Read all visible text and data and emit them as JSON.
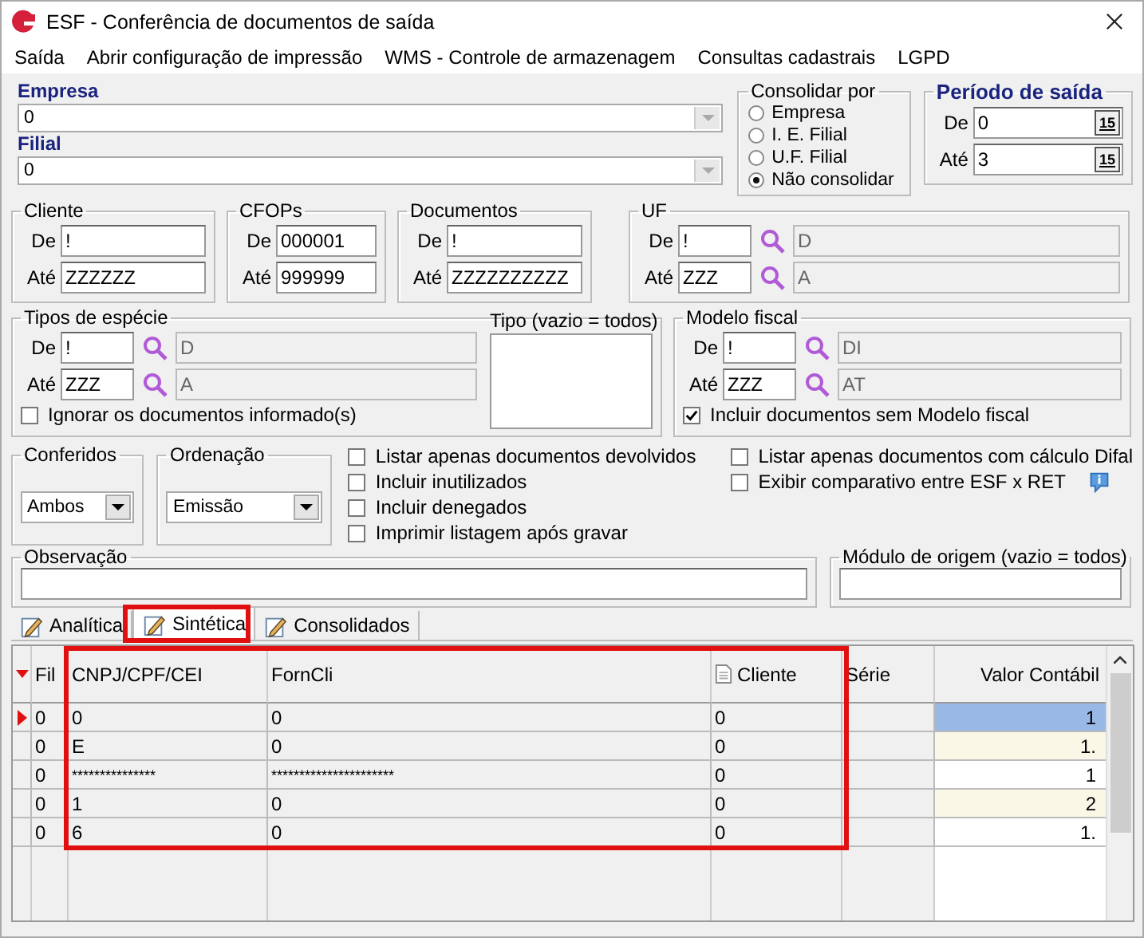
{
  "window": {
    "title": "ESF - Conferência de documentos de saída"
  },
  "menu": [
    "Saída",
    "Abrir configuração de impressão",
    "WMS - Controle de armazenagem",
    "Consultas cadastrais",
    "LGPD"
  ],
  "empresa": {
    "label": "Empresa",
    "value": "0"
  },
  "filial": {
    "label": "Filial",
    "value": "0"
  },
  "consolidar": {
    "title": "Consolidar por",
    "options": [
      {
        "label": "Empresa",
        "selected": false
      },
      {
        "label": "I. E. Filial",
        "selected": false
      },
      {
        "label": "U.F. Filial",
        "selected": false
      },
      {
        "label": "Não consolidar",
        "selected": true
      }
    ]
  },
  "periodo": {
    "title": "Período de saída",
    "rows": [
      {
        "label": "De",
        "value": "0",
        "button": "15"
      },
      {
        "label": "Até",
        "value": "3",
        "button": "15"
      }
    ]
  },
  "ranges": [
    {
      "title": "Cliente",
      "rows": [
        {
          "label": "De",
          "value": "!"
        },
        {
          "label": "Até",
          "value": "ZZZZZZ"
        }
      ]
    },
    {
      "title": "CFOPs",
      "rows": [
        {
          "label": "De",
          "value": "000001"
        },
        {
          "label": "Até",
          "value": "999999"
        }
      ]
    },
    {
      "title": "Documentos",
      "rows": [
        {
          "label": "De",
          "value": "!"
        },
        {
          "label": "Até",
          "value": "ZZZZZZZZZZ"
        }
      ]
    }
  ],
  "uf": {
    "title": "UF",
    "rows": [
      {
        "label": "De",
        "value": "!",
        "description": "D"
      },
      {
        "label": "Até",
        "value": "ZZZ",
        "description": "A"
      }
    ]
  },
  "tipos": {
    "title": "Tipos de espécie",
    "rows": [
      {
        "label": "De",
        "value": "!",
        "description": "D"
      },
      {
        "label": "Até",
        "value": "ZZZ",
        "description": "A"
      }
    ],
    "checkbox": {
      "label": "Ignorar os documentos informado(s)",
      "checked": false
    },
    "tipo_label": "Tipo (vazio = todos)"
  },
  "modelo": {
    "title": "Modelo fiscal",
    "rows": [
      {
        "label": "De",
        "value": "!",
        "description": "DI"
      },
      {
        "label": "Até",
        "value": "ZZZ",
        "description": "AT"
      }
    ],
    "checkbox": {
      "label": "Incluir documentos sem Modelo fiscal",
      "checked": true
    }
  },
  "conferidos": {
    "title": "Conferidos",
    "value": "Ambos"
  },
  "ordenacao": {
    "title": "Ordenação",
    "value": "Emissão"
  },
  "options_left": [
    {
      "label": "Listar apenas documentos devolvidos",
      "checked": false
    },
    {
      "label": "Incluir inutilizados",
      "checked": false
    },
    {
      "label": "Incluir denegados",
      "checked": false
    },
    {
      "label": "Imprimir listagem após gravar",
      "checked": false
    }
  ],
  "options_right": [
    {
      "label": "Listar apenas documentos com cálculo Difal",
      "checked": false
    },
    {
      "label": "Exibir comparativo entre ESF x  RET",
      "checked": false
    }
  ],
  "observacao": {
    "label": "Observação"
  },
  "modulo": {
    "label": "Módulo de origem (vazio = todos)"
  },
  "tabs": [
    {
      "label": "Analítica",
      "selected": false
    },
    {
      "label": "Sintética",
      "selected": true
    },
    {
      "label": "Consolidados",
      "selected": false
    }
  ],
  "table": {
    "columns": [
      "Fil",
      "CNPJ/CPF/CEI",
      "FornCli",
      "Cliente",
      "Série",
      "Valor Contábil"
    ],
    "rows": [
      {
        "cells": [
          "0",
          "0",
          "0",
          "0",
          "",
          "1"
        ],
        "selected": true
      },
      {
        "cells": [
          "0",
          "E",
          "0",
          "0",
          "",
          "1."
        ],
        "selected": false
      },
      {
        "cells": [
          "0",
          "***************",
          "**********************",
          "0",
          "",
          "1"
        ],
        "selected": false
      },
      {
        "cells": [
          "0",
          "1",
          "0",
          "0",
          "",
          "2"
        ],
        "selected": false
      },
      {
        "cells": [
          "0",
          "6",
          "0",
          "0",
          "",
          "1."
        ],
        "selected": false
      }
    ]
  }
}
